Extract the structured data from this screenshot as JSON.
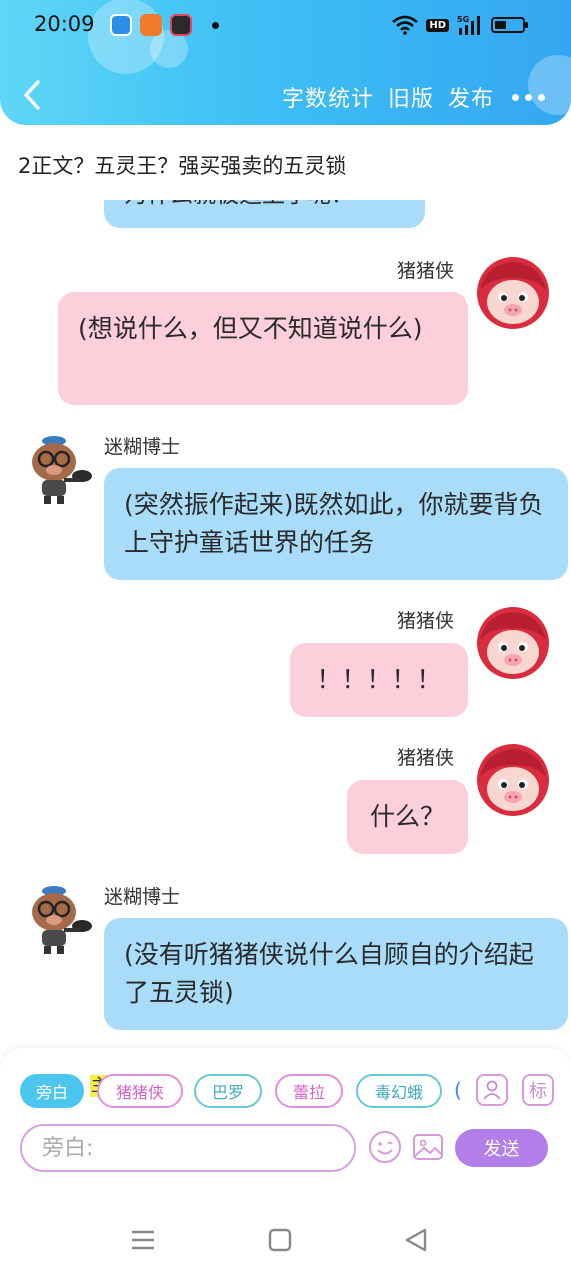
{
  "status_bar": {
    "time": "20:09",
    "network_badge": "HD",
    "signal_badge": "5G"
  },
  "header": {
    "back_icon": "chevron-left-icon",
    "word_count": "字数统计",
    "old_version": "旧版",
    "publish": "发布",
    "more_icon": "more-dots-icon"
  },
  "story": {
    "title": "2正文？五灵王？强买强卖的五灵锁"
  },
  "messages": [
    {
      "speaker": "迷糊博士",
      "side": "left",
      "color": "blue",
      "text": "为什么就被选上了呢？"
    },
    {
      "speaker": "猪猪侠",
      "side": "right",
      "color": "pink",
      "text": "(想说什么，但又不知道说什么)"
    },
    {
      "speaker": "迷糊博士",
      "side": "left",
      "color": "blue",
      "text": "(突然振作起来)既然如此，你就要背负上守护童话世界的任务"
    },
    {
      "speaker": "猪猪侠",
      "side": "right",
      "color": "pink",
      "text": "！！！！！"
    },
    {
      "speaker": "猪猪侠",
      "side": "right",
      "color": "pink",
      "text": "什么？"
    },
    {
      "speaker": "迷糊博士",
      "side": "left",
      "color": "blue",
      "text": "(没有听猪猪侠说什么自顾自的介绍起了五灵锁)"
    }
  ],
  "composer": {
    "roles": [
      "旁白",
      "猪猪侠",
      "巴罗",
      "蕾拉",
      "毒幻蛾"
    ],
    "main_marker": "主",
    "overflow_paren": "(",
    "tag_button": "标",
    "placeholder": "旁白:",
    "send": "发送"
  },
  "colors": {
    "accent_blue": "#3ebff4",
    "bubble_blue": "#a9dcf9",
    "bubble_pink": "#fccfda",
    "send_purple": "#b37ee8"
  }
}
